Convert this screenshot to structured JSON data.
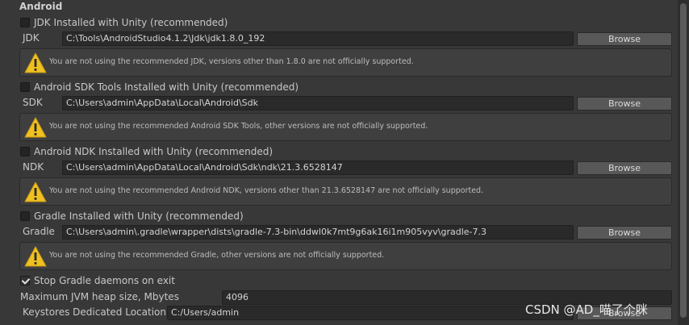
{
  "section": {
    "title": "Android"
  },
  "jdk": {
    "checkbox_label": "JDK Installed with Unity (recommended)",
    "checked": false,
    "field_label": "JDK",
    "path": "C:\\Tools\\AndroidStudio4.1.2\\Jdk\\jdk1.8.0_192",
    "browse_label": "Browse",
    "warning": "You are not using the recommended JDK, versions other than 1.8.0 are not officially supported."
  },
  "sdk": {
    "checkbox_label": "Android SDK Tools Installed with Unity (recommended)",
    "checked": false,
    "field_label": "SDK",
    "path": "C:\\Users\\admin\\AppData\\Local\\Android\\Sdk",
    "browse_label": "Browse",
    "warning": "You are not using the recommended Android SDK Tools, other versions are not officially supported."
  },
  "ndk": {
    "checkbox_label": "Android NDK Installed with Unity (recommended)",
    "checked": false,
    "field_label": "NDK",
    "path": "C:\\Users\\admin\\AppData\\Local\\Android\\Sdk\\ndk\\21.3.6528147",
    "browse_label": "Browse",
    "warning": "You are not using the recommended Android NDK, versions other than 21.3.6528147 are not officially supported."
  },
  "gradle": {
    "checkbox_label": "Gradle Installed with Unity (recommended)",
    "checked": false,
    "field_label": "Gradle",
    "path": "C:\\Users\\admin\\.gradle\\wrapper\\dists\\gradle-7.3-bin\\ddwl0k7mt9g6ak16i1m905vyv\\gradle-7.3",
    "browse_label": "Browse",
    "warning": "You are not using the recommended Gradle, other versions are not officially supported."
  },
  "stop_gradle": {
    "label": "Stop Gradle daemons on exit",
    "checked": true
  },
  "jvm_heap": {
    "label": "Maximum JVM heap size, Mbytes",
    "value": "4096"
  },
  "keystores": {
    "label": "Keystores Dedicated Location",
    "value": "C:/Users/admin",
    "browse_label": "Browse"
  },
  "watermark": "CSDN @AD_喵了个咪",
  "colors": {
    "background": "#383838",
    "warning_icon": "#f0c020",
    "field_bg": "#2a2a2a",
    "button_bg": "#585858"
  }
}
